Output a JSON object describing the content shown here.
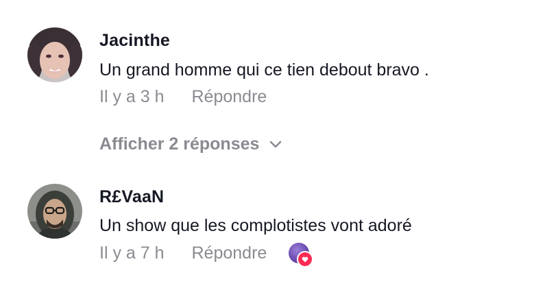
{
  "comments": [
    {
      "username": "Jacinthe",
      "text": "Un grand homme qui ce tien debout bravo .",
      "time": "Il y a 3 h",
      "reply_label": "Répondre",
      "avatar_icon": "user-avatar-photo"
    },
    {
      "username": "R£VaaN",
      "text": "Un show que les complotistes vont adoré",
      "time": "Il y a 7 h",
      "reply_label": "Répondre",
      "avatar_icon": "user-avatar-photo",
      "creator_liked": true
    }
  ],
  "view_replies": {
    "label": "Afficher 2 réponses",
    "icon": "chevron-down-icon"
  },
  "colors": {
    "primary_text": "#161823",
    "secondary_text": "#8a8b91",
    "like_accent": "#fe2c55"
  }
}
